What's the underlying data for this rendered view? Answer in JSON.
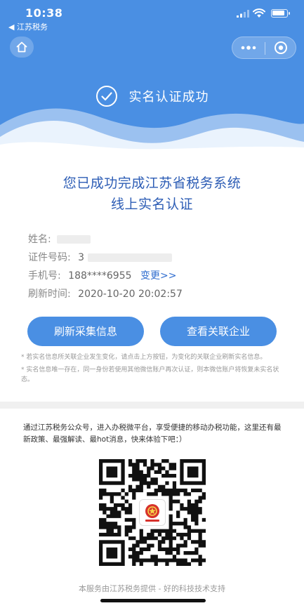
{
  "status_bar": {
    "time": "10:38",
    "back_label": "◀ 江苏税务"
  },
  "header": {
    "success_text": "实名认证成功"
  },
  "main": {
    "title_line1": "您已成功完成江苏省税务系统",
    "title_line2": "线上实名认证"
  },
  "info": {
    "name_label": "姓名:",
    "id_label": "证件号码:",
    "id_value_visible": "3",
    "phone_label": "手机号:",
    "phone_value": "188****6955",
    "change_link": "变更>>",
    "refresh_time_label": "刷新时间:",
    "refresh_time_value": "2020-10-20 20:02:57"
  },
  "buttons": {
    "refresh_label": "刷新采集信息",
    "company_label": "查看关联企业"
  },
  "notes": [
    "* 若实名信息所关联企业发生变化，请点击上方按钮，为变化的关联企业刷新实名信息。",
    "* 实名信息唯一存在，同一身份若使用其他微信账户再次认证，则本微信账户将恢复未实名状态。"
  ],
  "promo": {
    "text": "通过江苏税务公众号，进入办税微平台，享受便捷的移动办税功能，这里还有最新政策、最强解读、最hot消息，快来体验下吧：）"
  },
  "qr": {
    "logo_text": "中国税务"
  },
  "footer": {
    "text": "本服务由江苏税务提供 - 好的科技技术支持"
  },
  "colors": {
    "brand": "#4a8fe3",
    "title": "#2d5db5",
    "link": "#2e6ccf"
  },
  "icons": [
    "home-icon",
    "more-dots-icon",
    "record-icon",
    "check-circle-icon",
    "signal-icon",
    "wifi-icon",
    "battery-icon"
  ]
}
